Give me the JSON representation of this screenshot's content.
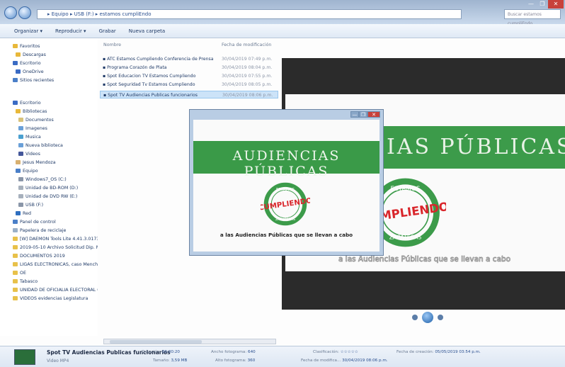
{
  "window": {
    "address": "▸ Equipo ▸ USB (F:) ▸ estamos cumpliEndo",
    "search_placeholder": "Buscar estamos cumpliEndo",
    "controls": [
      "—",
      "❐",
      "✕"
    ]
  },
  "toolbar": {
    "organize": "Organizar ▾",
    "play": "Reproducir ▾",
    "burn": "Grabar",
    "new_folder": "Nueva carpeta"
  },
  "sidebar": {
    "items": [
      {
        "label": "Favoritos",
        "icon": "star-icon"
      },
      {
        "label": "Descargas",
        "icon": "folder-icon"
      },
      {
        "label": "Escritorio",
        "icon": "desktop-icon"
      },
      {
        "label": "OneDrive",
        "icon": "cloud-icon"
      },
      {
        "label": "Sitios recientes",
        "icon": "recent-icon"
      },
      {
        "label": "Escritorio",
        "icon": "desktop-icon"
      },
      {
        "label": "Bibliotecas",
        "icon": "library-icon"
      },
      {
        "label": "Documentos",
        "icon": "documents-icon"
      },
      {
        "label": "Imagenes",
        "icon": "images-icon"
      },
      {
        "label": "Musica",
        "icon": "music-icon"
      },
      {
        "label": "Nueva biblioteca",
        "icon": "library-icon"
      },
      {
        "label": "Videos",
        "icon": "video-icon"
      },
      {
        "label": "Jesus Mendoza",
        "icon": "user-icon"
      },
      {
        "label": "Equipo",
        "icon": "computer-icon"
      },
      {
        "label": "Windows7_OS (C:)",
        "icon": "drive-icon"
      },
      {
        "label": "Unidad de BD-ROM (D:)",
        "icon": "disc-icon"
      },
      {
        "label": "Unidad de DVD RW (E:)",
        "icon": "disc-icon"
      },
      {
        "label": "USB (F:)",
        "icon": "usb-icon"
      },
      {
        "label": "Red",
        "icon": "network-icon"
      },
      {
        "label": "Panel de control",
        "icon": "control-panel-icon"
      },
      {
        "label": "Papelera de reciclaje",
        "icon": "recycle-icon"
      },
      {
        "label": "[W] DAEMON Tools Lite 4.41.3.0173",
        "icon": "folder-icon"
      },
      {
        "label": "2019-05-10 Archivo Solicitud Dip. M",
        "icon": "folder-icon"
      },
      {
        "label": "DOCUMENTOS 2019",
        "icon": "folder-icon"
      },
      {
        "label": "LIGAS ELECTRONICAS, caso Menchac",
        "icon": "folder-icon"
      },
      {
        "label": "OE",
        "icon": "folder-icon"
      },
      {
        "label": "Tabasco",
        "icon": "folder-icon"
      },
      {
        "label": "UNIDAD DE OFICIALIA ELECTORAL (",
        "icon": "folder-icon"
      },
      {
        "label": "VIDEOS evidencias Legislatura",
        "icon": "folder-icon"
      }
    ]
  },
  "columns": {
    "name": "Nombre",
    "date": "Fecha de modificación"
  },
  "files": [
    {
      "name": "ATC Estamos Cumpliendo Conferencia de Prensa",
      "date": "30/04/2019 07:49 p.m."
    },
    {
      "name": "Programa Corazón de Plata",
      "date": "30/04/2019 08:04 p.m."
    },
    {
      "name": "Spot Educacion TV Estamos Cumpliendo",
      "date": "30/04/2019 07:55 p.m."
    },
    {
      "name": "Spot Seguridad Tv Estamos Cumpliendo",
      "date": "30/04/2019 08:05 p.m."
    },
    {
      "name": "Spot TV Audiencias Publicas funcionarios",
      "date": "30/04/2019 08:06 p.m.",
      "selected": true
    }
  ],
  "video": {
    "banner": "AUDIENCIAS PÚBLICAS",
    "preview_banner": "CIAS PÚBLICAS",
    "seal_top": "ESTAMOS",
    "seal_main": "CUMPLIENDO",
    "seal_bottom": "ZACATECAS",
    "caption": "a las Audiencias Públicas que se llevan a cabo"
  },
  "details": {
    "file_name": "Spot TV Audiencias Publicas funcionarios",
    "type": "Video MP4",
    "duration_label": "Duración:",
    "duration": "00:00:20",
    "size_label": "Tamaño:",
    "size": "3,59 MB",
    "width_label": "Ancho fotograma:",
    "width": "640",
    "height_label": "Alto fotograma:",
    "height": "360",
    "rating_label": "Clasificación:",
    "rating": "☆☆☆☆☆",
    "modified_label": "Fecha de modifica...",
    "modified": "30/04/2019 08:06 p.m.",
    "created_label": "Fecha de creación:",
    "created": "05/05/2019 03:54 p.m."
  },
  "colors": {
    "green": "#3c9b4a",
    "seal_red": "#d9262b",
    "seal_green": "#3c9b4a"
  }
}
